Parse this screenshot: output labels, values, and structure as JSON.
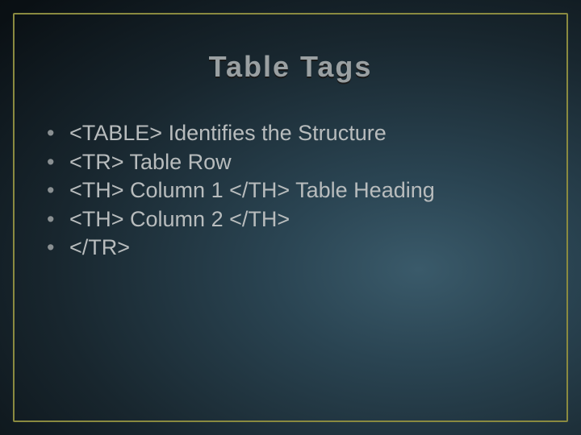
{
  "slide": {
    "title": "Table Tags",
    "bullets": [
      "<TABLE> Identifies the Structure",
      "<TR> Table Row",
      "<TH> Column 1 </TH> Table Heading",
      "<TH> Column 2 </TH>",
      "</TR>"
    ]
  }
}
